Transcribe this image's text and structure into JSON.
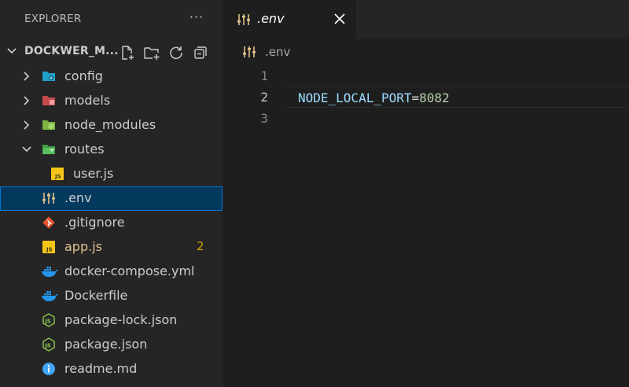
{
  "explorer": {
    "title": "EXPLORER",
    "more_label": "···",
    "folder_name": "DOCKWER_M...",
    "folder_actions": [
      "new-file-icon",
      "new-folder-icon",
      "refresh-icon",
      "collapse-all-icon"
    ],
    "items": [
      {
        "label": "config",
        "icon": "folder-config-icon",
        "type": "folder",
        "expanded": false
      },
      {
        "label": "models",
        "icon": "folder-models-icon",
        "type": "folder",
        "expanded": false
      },
      {
        "label": "node_modules",
        "icon": "folder-node-icon",
        "type": "folder",
        "expanded": false
      },
      {
        "label": "routes",
        "icon": "folder-routes-icon",
        "type": "folder",
        "expanded": true
      },
      {
        "label": "user.js",
        "icon": "js-file-icon",
        "type": "file",
        "indent": 1
      },
      {
        "label": ".env",
        "icon": "settings-file-icon",
        "type": "file",
        "selected": true
      },
      {
        "label": ".gitignore",
        "icon": "git-icon",
        "type": "file"
      },
      {
        "label": "app.js",
        "icon": "js-file-icon",
        "type": "file",
        "badge": "2",
        "modified": true
      },
      {
        "label": "docker-compose.yml",
        "icon": "docker-icon",
        "type": "file"
      },
      {
        "label": "Dockerfile",
        "icon": "docker-icon",
        "type": "file"
      },
      {
        "label": "package-lock.json",
        "icon": "node-json-icon",
        "type": "file"
      },
      {
        "label": "package.json",
        "icon": "node-json-icon",
        "type": "file"
      },
      {
        "label": "readme.md",
        "icon": "info-icon",
        "type": "file"
      }
    ]
  },
  "editor": {
    "tab": {
      "label": ".env",
      "close": "×"
    },
    "breadcrumb": ".env",
    "lines": [
      {
        "num": "1",
        "key": "",
        "eq": "",
        "value": ""
      },
      {
        "num": "2",
        "key": "NODE_LOCAL_PORT",
        "eq": "=",
        "value": "8082",
        "active": true
      },
      {
        "num": "3",
        "key": "",
        "eq": "",
        "value": ""
      }
    ]
  },
  "colors": {
    "selection_bg": "#04395e",
    "selection_border": "#0078d4",
    "badge": "#cca700",
    "key": "#9cdcfe",
    "number": "#b5cea8"
  }
}
